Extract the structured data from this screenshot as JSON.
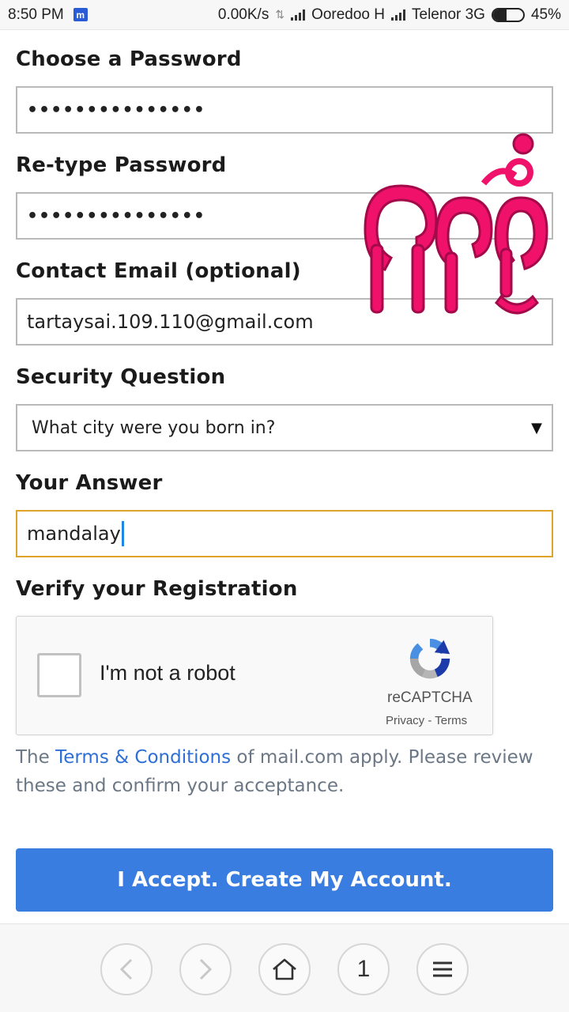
{
  "status_bar": {
    "time": "8:50 PM",
    "app_icon_letter": "m",
    "net_speed": "0.00K/s",
    "carrier1": "Ooredoo H",
    "carrier2": "Telenor 3G",
    "battery": "45%",
    "battery_level": 0.45
  },
  "form": {
    "password_label": "Choose a Password",
    "password_value": "•••••••••••••••",
    "retype_label": "Re-type Password",
    "retype_value": "•••••••••••••••",
    "email_label": "Contact Email (optional)",
    "email_value": "tartaysai.109.110@gmail.com",
    "question_label": "Security Question",
    "question_value": "What city were you born in?",
    "answer_label": "Your Answer",
    "answer_value": "mandalay",
    "verify_label": "Verify your Registration"
  },
  "captcha": {
    "label": "I'm not a robot",
    "brand": "reCAPTCHA",
    "links": "Privacy - Terms"
  },
  "terms": {
    "prefix": "The ",
    "link": "Terms & Conditions",
    "suffix": " of mail.com apply. Please review these and confirm your acceptance."
  },
  "accept_button": "I Accept. Create My Account.",
  "browser_nav": {
    "tab_count": "1"
  },
  "watermark_text": "နေစသပိုင်",
  "colors": {
    "accent": "#3a7de0",
    "focus_border": "#e0a42b",
    "link": "#2d6fd6",
    "watermark": "#f0126a"
  }
}
